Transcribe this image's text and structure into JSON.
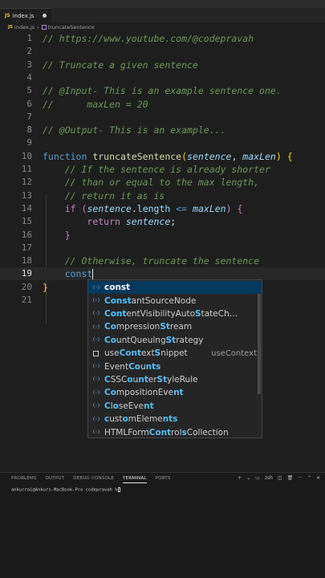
{
  "window": {
    "title": ""
  },
  "tab": {
    "label": "index.js",
    "icon": "js-file-icon",
    "modified": true
  },
  "breadcrumb": {
    "file": "index.js",
    "symbol": "truncateSentence"
  },
  "editor": {
    "current_line": 19,
    "line_numbers": [
      "1",
      "2",
      "3",
      "4",
      "5",
      "6",
      "7",
      "8",
      "9",
      "10",
      "11",
      "12",
      "13",
      "14",
      "15",
      "16",
      "17",
      "18",
      "19",
      "20",
      "21"
    ],
    "lines": {
      "l1": "// https://www.youtube.com/@codepravah",
      "l3": "// Truncate a given sentence",
      "l5": "// @Input- This is an example sentence one.",
      "l6": "//      maxLen = 20",
      "l8": "// @Output- This is an example...",
      "l10_kw": "function",
      "l10_fn": "truncateSentence",
      "l10_p1": "sentence",
      "l10_p2": "maxLen",
      "l11": "// If the sentence is already shorter",
      "l12": "// than or equal to the max length,",
      "l13": "// return it as is",
      "l14_kw": "if",
      "l14_obj": "sentence",
      "l14_prop": "length",
      "l14_op": "<=",
      "l14_var": "maxLen",
      "l15_kw": "return",
      "l15_var": "sentence",
      "l18": "// Otherwise, truncate the sentence",
      "l19": "const"
    }
  },
  "suggestions": [
    {
      "hl1": "const",
      "rest1": "",
      "hl2": "",
      "rest2": "",
      "hl3": "",
      "rest3": "",
      "detail": "",
      "icon": "variable-icon"
    },
    {
      "hl1": "Const",
      "rest1": "antSourceNode",
      "hl2": "",
      "rest2": "",
      "hl3": "",
      "rest3": "",
      "detail": "",
      "icon": "variable-icon"
    },
    {
      "hl1": "Cont",
      "rest1": "entVisibilityAuto",
      "hl2": "S",
      "rest2": "tateCh…",
      "hl3": "",
      "rest3": "",
      "detail": "",
      "icon": "variable-icon"
    },
    {
      "hl1": "Co",
      "rest1": "mpression",
      "hl2": "St",
      "rest2": "ream",
      "hl3": "",
      "rest3": "",
      "detail": "",
      "icon": "variable-icon"
    },
    {
      "hl1": "Co",
      "rest1": "untQueuing",
      "hl2": "St",
      "rest2": "rategy",
      "hl3": "",
      "rest3": "",
      "detail": "",
      "icon": "variable-icon"
    },
    {
      "hl1": "",
      "rest1": "use",
      "hl2": "Cont",
      "rest2": "ext",
      "hl3": "S",
      "rest3": "nippet",
      "detail": "useContext",
      "icon": "snippet-icon"
    },
    {
      "hl1": "",
      "rest1": "Event",
      "hl2": "Co",
      "rest2": "u",
      "hl3": "nts",
      "rest3": "",
      "detail": "",
      "icon": "variable-icon"
    },
    {
      "hl1": "C",
      "rest1": "SSC",
      "hl2": "o",
      "rest2": "u",
      "hl3": "nt",
      "rest3": "er",
      "hl4": "St",
      "rest4": "yleRule",
      "detail": "",
      "icon": "variable-icon"
    },
    {
      "hl1": "Co",
      "rest1": "mpositionEve",
      "hl2": "nt",
      "rest2": "",
      "hl3": "",
      "rest3": "",
      "detail": "",
      "icon": "variable-icon"
    },
    {
      "hl1": "C",
      "rest1": "l",
      "hl2": "o",
      "rest2": "seEve",
      "hl3": "nt",
      "rest3": "",
      "detail": "",
      "icon": "variable-icon"
    },
    {
      "hl1": "c",
      "rest1": "ust",
      "hl2": "o",
      "rest2": "mEleme",
      "hl3": "nts",
      "rest3": "",
      "detail": "",
      "icon": "variable-icon"
    },
    {
      "hl1": "",
      "rest1": "HTMLForm",
      "hl2": "Cont",
      "rest2": "rol",
      "hl3": "s",
      "rest3": "Collection",
      "detail": "",
      "icon": "variable-icon"
    }
  ],
  "panel": {
    "tabs": [
      "PROBLEMS",
      "OUTPUT",
      "DEBUG CONSOLE",
      "TERMINAL",
      "PORTS"
    ],
    "active_tab": "TERMINAL",
    "shell": "zsh",
    "prompt": "ankurrai@Ankurs-MacBook-Pro codepravah %"
  }
}
